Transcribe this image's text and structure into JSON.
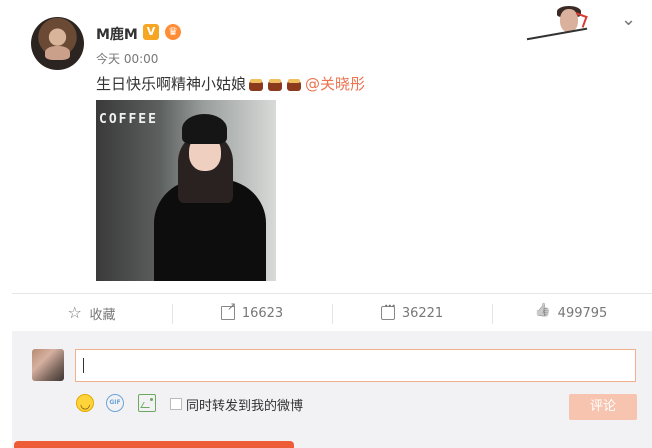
{
  "post": {
    "username": "M鹿M",
    "verified_badge": "V",
    "member_badge": "♛",
    "time": "今天 00:00",
    "text": "生日快乐啊精神小姑娘",
    "mention": "@关晓彤",
    "photo": {
      "sign_text": "COFFEE"
    }
  },
  "actions": {
    "favorite_label": "收藏",
    "repost_count": "16623",
    "comment_count": "36221",
    "like_count": "499795"
  },
  "comment_box": {
    "checkbox_label": "同时转发到我的微博",
    "submit_label": "评论",
    "input_value": "",
    "input_placeholder": ""
  },
  "icons": {
    "top_right_menu": "chevron-down-icon",
    "favorite": "star-icon",
    "repost": "repost-icon",
    "comment": "comment-icon",
    "like": "thumbs-up-icon",
    "emoji": "smile-icon",
    "gif": "gif-icon",
    "image": "image-icon"
  },
  "colors": {
    "mention": "#eb7350",
    "input_border": "#f0b08c",
    "submit_disabled": "#f7c4b0",
    "comment_background": "#f2f2f5"
  }
}
